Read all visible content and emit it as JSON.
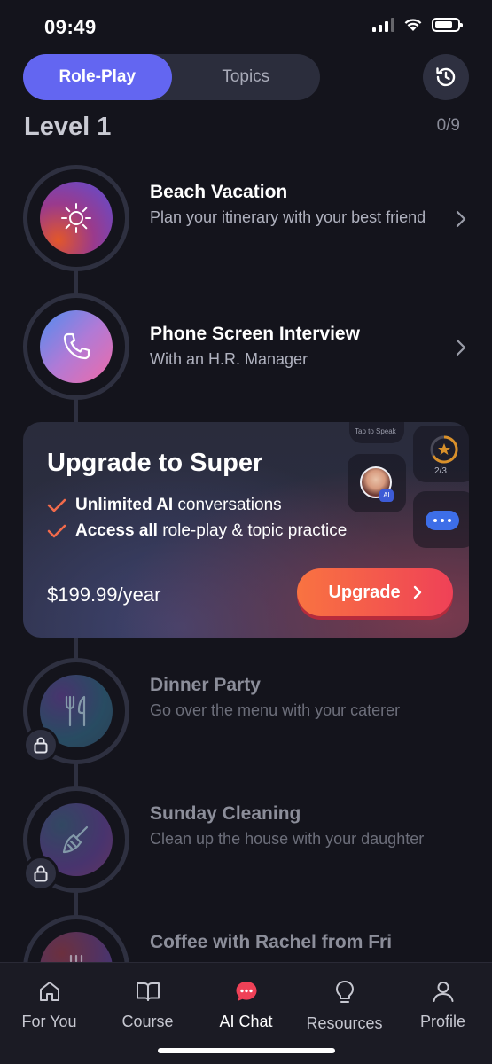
{
  "status_bar": {
    "time": "09:49"
  },
  "tabs": [
    {
      "label": "Role-Play",
      "active": true
    },
    {
      "label": "Topics",
      "active": false
    }
  ],
  "history_icon": "history-icon",
  "level": {
    "title": "Level 1",
    "progress": "0/9"
  },
  "lessons": [
    {
      "title": "Beach Vacation",
      "subtitle": "Plan your itinerary with your best friend",
      "icon": "sun-icon",
      "locked": false
    },
    {
      "title": "Phone Screen Interview",
      "subtitle": "With an H.R. Manager",
      "icon": "phone-icon",
      "locked": false
    },
    {
      "title": "Dinner Party",
      "subtitle": "Go over the menu with your caterer",
      "icon": "fork-knife-icon",
      "locked": true
    },
    {
      "title": "Sunday Cleaning",
      "subtitle": "Clean up the house with your daughter",
      "icon": "broom-icon",
      "locked": true
    },
    {
      "title": "Coffee with Rachel from Fri",
      "subtitle": "",
      "icon": "coffee-icon",
      "locked": true
    }
  ],
  "upgrade": {
    "title": "Upgrade to Super",
    "features": [
      {
        "bold": "Unlimited AI",
        "rest": " conversations"
      },
      {
        "bold": "Access all",
        "rest": " role-play & topic practice"
      }
    ],
    "price": "$199.99/year",
    "button_label": "Upgrade",
    "deco": {
      "tap_label": "Tap to Speak",
      "progress": "2/3",
      "ai_badge": "AI"
    }
  },
  "nav": [
    {
      "label": "For You",
      "icon": "home-icon",
      "active": false
    },
    {
      "label": "Course",
      "icon": "book-icon",
      "active": false
    },
    {
      "label": "AI Chat",
      "icon": "chat-icon",
      "active": true
    },
    {
      "label": "Resources",
      "icon": "lightbulb-icon",
      "active": false
    },
    {
      "label": "Profile",
      "icon": "user-icon",
      "active": false
    }
  ],
  "colors": {
    "accent": "#6366f1",
    "upgrade_start": "#f97341",
    "upgrade_end": "#ef4157",
    "chat_active": "#ef4157"
  }
}
